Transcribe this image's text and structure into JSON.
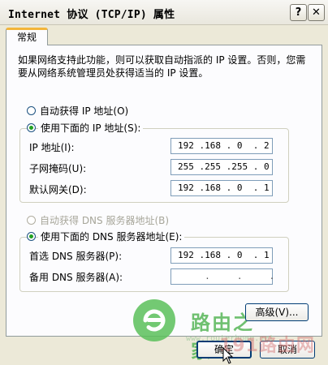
{
  "window": {
    "title": "Internet 协议 (TCP/IP) 属性",
    "help_label": "?",
    "close_label": "✕"
  },
  "tab": {
    "label": "常规"
  },
  "description": "如果网络支持此功能，则可以获取自动指派的 IP 设置。否则，您需要从网络系统管理员处获得适当的 IP 设置。",
  "ip_section": {
    "auto_label": "自动获得 IP 地址(O)",
    "manual_label": "使用下面的 IP 地址(S):",
    "selected": "manual",
    "fields": [
      {
        "label": "IP 地址(I):",
        "value": "192 .168 . 0  . 2"
      },
      {
        "label": "子网掩码(U):",
        "value": "255 .255 .255 . 0"
      },
      {
        "label": "默认网关(D):",
        "value": "192 .168 . 0  . 1"
      }
    ]
  },
  "dns_section": {
    "auto_label": "自动获得 DNS 服务器地址(B)",
    "manual_label": "使用下面的 DNS 服务器地址(E):",
    "selected": "manual",
    "fields": [
      {
        "label": "首选 DNS 服务器(P):",
        "value": "192 .168 . 0  . 1"
      },
      {
        "label": "备用 DNS 服务器(A):",
        "value": "     .     .     ."
      }
    ]
  },
  "buttons": {
    "advanced": "高级(V)...",
    "ok": "确定",
    "cancel": "取消"
  },
  "watermark": {
    "brand": "路由之家",
    "url": "www.routerhome.net",
    "overlay": "191路由网"
  },
  "colors": {
    "accent_tab": "#f3b53b",
    "radio_dot": "#21a121",
    "watermark_green": "#4db24d"
  }
}
